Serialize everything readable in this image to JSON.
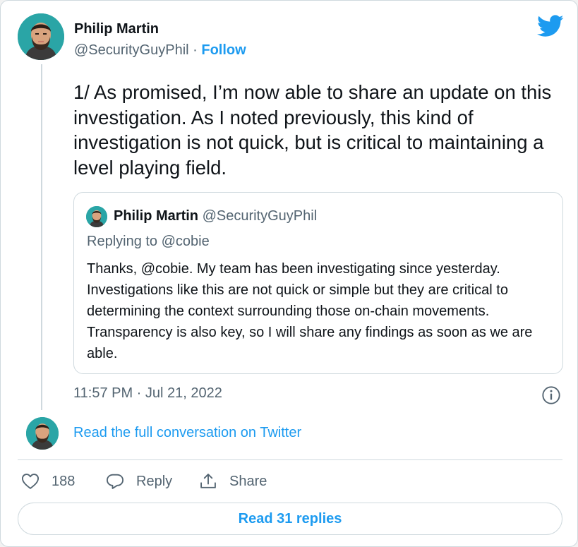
{
  "author": {
    "name": "Philip Martin",
    "handle": "@SecurityGuyPhil",
    "separator": "·",
    "follow_label": "Follow",
    "avatar_icon": "profile-avatar"
  },
  "tweet": {
    "text": "1/ As promised, I’m now able to share an update on this investigation. As I noted previously, this kind of investigation is not quick, but is critical to maintaining a level playing field.",
    "timestamp": "11:57 PM · Jul 21, 2022"
  },
  "quoted_tweet": {
    "name": "Philip Martin",
    "handle": "@SecurityGuyPhil",
    "replying_to": "Replying to @cobie",
    "text": "Thanks, @cobie. My team has been investigating since yesterday. Investigations like this are not quick or simple but they are critical to determining the context surrounding those on-chain movements. Transparency is also key, so I will share any findings as soon as we are able."
  },
  "conversation": {
    "read_full_label": "Read the full conversation on Twitter"
  },
  "actions": {
    "like_count": "188",
    "reply_label": "Reply",
    "share_label": "Share",
    "read_replies_label": "Read 31 replies"
  },
  "colors": {
    "accent": "#1d9bf0",
    "text": "#0f1419",
    "secondary": "#536471",
    "border": "#cfd9de"
  },
  "icons": [
    "twitter-bird-icon",
    "info-icon",
    "heart-icon",
    "reply-bubble-icon",
    "share-upload-icon"
  ]
}
